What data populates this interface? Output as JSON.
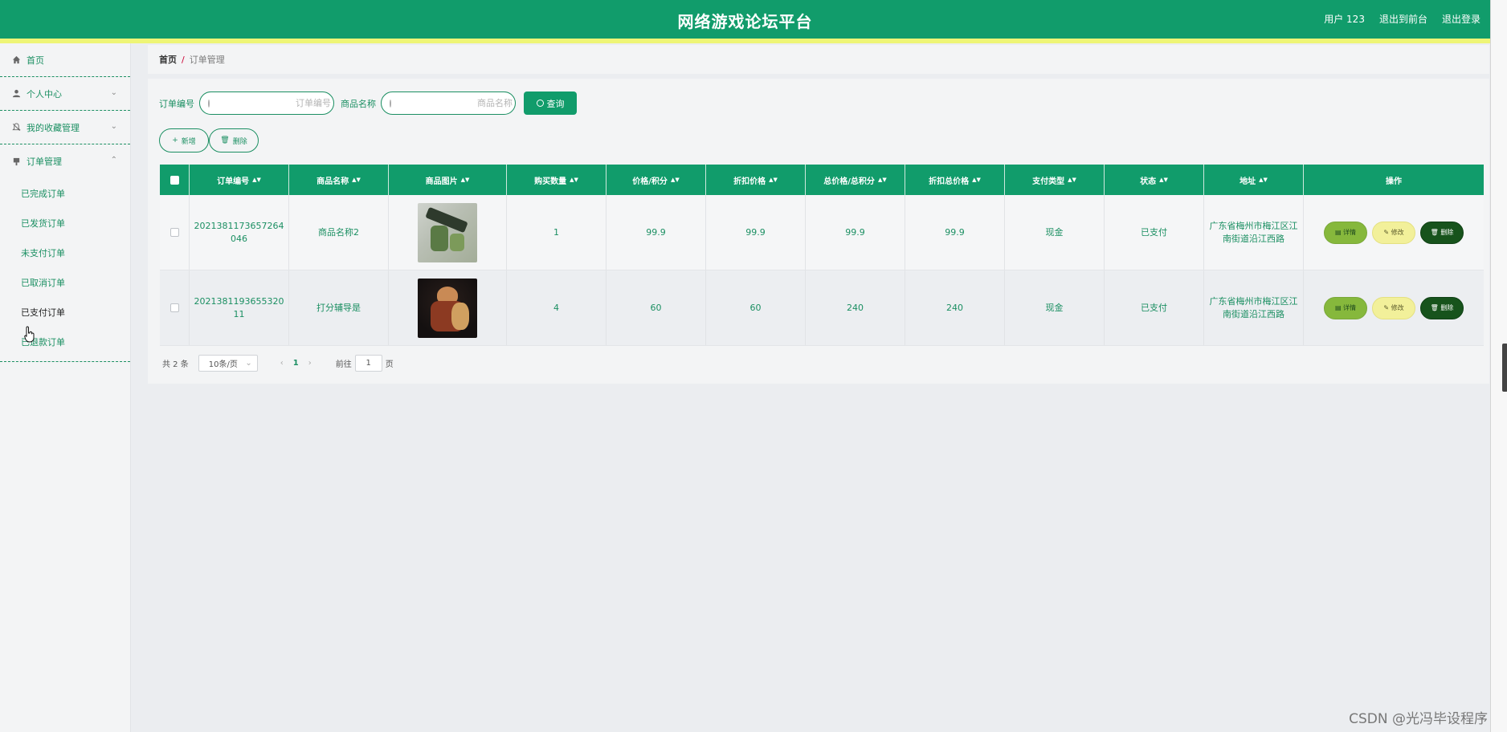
{
  "header": {
    "title": "网络游戏论坛平台",
    "links": [
      "用户 123",
      "退出到前台",
      "退出登录"
    ]
  },
  "sidebar": {
    "items": [
      {
        "label": "首页",
        "icon": "home-icon"
      },
      {
        "label": "个人中心",
        "icon": "user-icon"
      },
      {
        "label": "我的收藏管理",
        "icon": "bell-icon"
      },
      {
        "label": "订单管理",
        "icon": "ticket-icon"
      }
    ],
    "subitems": [
      "已完成订单",
      "已发货订单",
      "未支付订单",
      "已取消订单",
      "已支付订单",
      "已退款订单"
    ]
  },
  "breadcrumb": {
    "home": "首页",
    "separator": "/",
    "current": "订单管理"
  },
  "search": {
    "order_label": "订单编号",
    "order_placeholder": "订单编号",
    "product_label": "商品名称",
    "product_placeholder": "商品名称",
    "query_button": "查询"
  },
  "actions": {
    "add": "新增",
    "delete": "删除"
  },
  "table": {
    "headers": [
      "订单编号",
      "商品名称",
      "商品图片",
      "购买数量",
      "价格/积分",
      "折扣价格",
      "总价格/总积分",
      "折扣总价格",
      "支付类型",
      "状态",
      "地址",
      "操作"
    ],
    "rows": [
      {
        "order_no": "2021381173657264046",
        "product": "商品名称2",
        "image": "rifle-image",
        "qty": "1",
        "price": "99.9",
        "discount_price": "99.9",
        "total": "99.9",
        "discount_total": "99.9",
        "pay_type": "现金",
        "status": "已支付",
        "address": "广东省梅州市梅江区江南街道沿江西路"
      },
      {
        "order_no": "202138119365532011",
        "product": "打分辅导是",
        "image": "warrior-image",
        "qty": "4",
        "price": "60",
        "discount_price": "60",
        "total": "240",
        "discount_total": "240",
        "pay_type": "现金",
        "status": "已支付",
        "address": "广东省梅州市梅江区江南街道沿江西路"
      }
    ],
    "op_labels": {
      "detail": "详情",
      "edit": "修改",
      "delete": "删除"
    }
  },
  "pagination": {
    "total": "共 2 条",
    "page_size": "10条/页",
    "current_page": "1",
    "goto_prefix": "前往",
    "goto_value": "1",
    "goto_suffix": "页"
  },
  "watermark": "CSDN @光冯毕设程序",
  "colors": {
    "primary": "#119c6b",
    "stripe": "#eef576",
    "text_green": "#1b8f62"
  }
}
